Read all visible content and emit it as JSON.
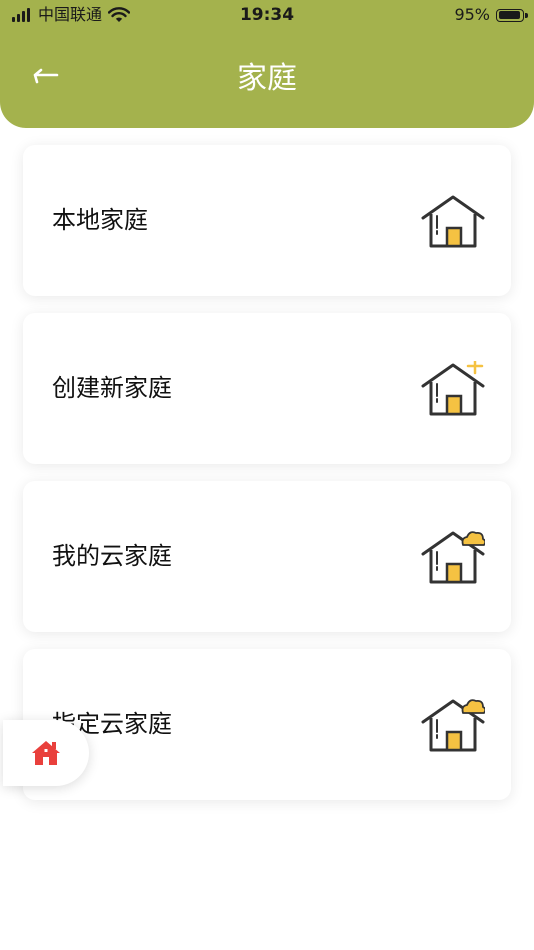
{
  "status_bar": {
    "carrier": "中国联通",
    "time": "19:34",
    "battery": "95%",
    "battery_level": 0.95
  },
  "header": {
    "title": "家庭",
    "back_icon": "back-arrow-icon"
  },
  "cards": [
    {
      "label": "本地家庭",
      "icon": "house-icon"
    },
    {
      "label": "创建新家庭",
      "icon": "house-plus-icon"
    },
    {
      "label": "我的云家庭",
      "icon": "house-cloud-icon"
    },
    {
      "label": "指定云家庭",
      "icon": "house-cloud-icon"
    }
  ],
  "floating_button": {
    "icon": "home-icon"
  },
  "colors": {
    "header_bg": "#a4b24d",
    "accent_yellow": "#f5c242",
    "icon_stroke": "#333333",
    "float_icon_red": "#e9403c"
  }
}
